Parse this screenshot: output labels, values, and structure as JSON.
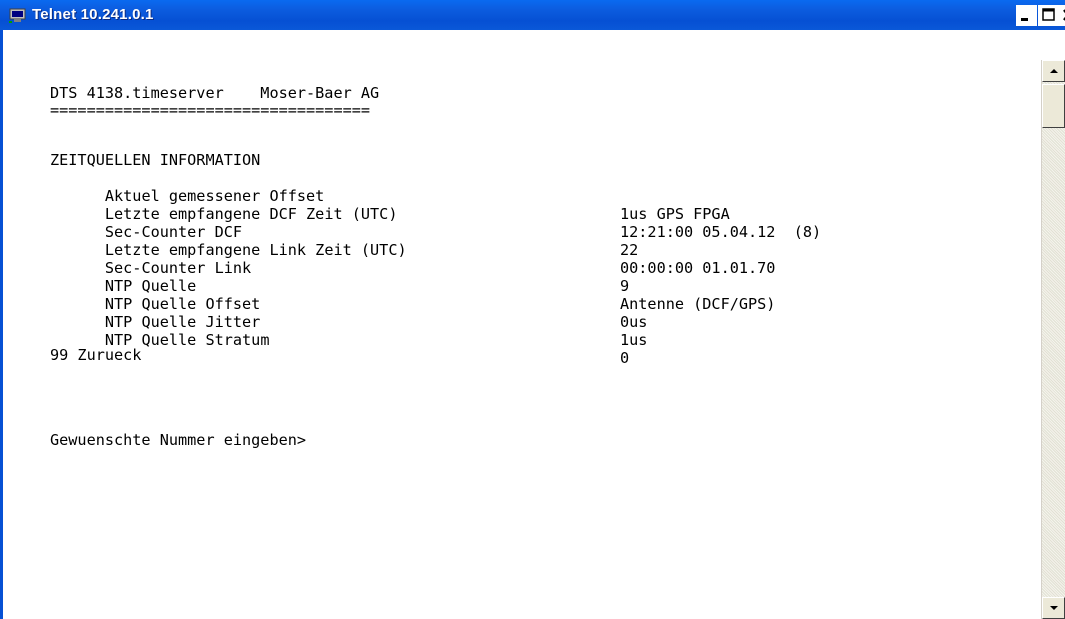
{
  "window": {
    "title": "Telnet 10.241.0.1",
    "icon": "telnet-terminal-icon",
    "controls": [
      "minimize-icon",
      "maximize-icon",
      "close-icon"
    ]
  },
  "terminal": {
    "header": "DTS 4138.timeserver    Moser-Baer AG",
    "separator": "===================================",
    "section_title": "ZEITQUELLEN INFORMATION",
    "rows": [
      {
        "label": "Aktuel gemessener Offset",
        "value": "1us GPS FPGA"
      },
      {
        "label": "Letzte empfangene DCF Zeit (UTC)",
        "value": "12:21:00 05.04.12  (8)"
      },
      {
        "label": "Sec-Counter DCF",
        "value": "22"
      },
      {
        "label": "Letzte empfangene Link Zeit (UTC)",
        "value": "00:00:00 01.01.70"
      },
      {
        "label": "Sec-Counter Link",
        "value": "9"
      },
      {
        "label": "NTP Quelle",
        "value": "Antenne (DCF/GPS)"
      },
      {
        "label": "NTP Quelle Offset",
        "value": "0us"
      },
      {
        "label": "NTP Quelle Jitter",
        "value": "1us"
      },
      {
        "label": "NTP Quelle Stratum",
        "value": "0"
      }
    ],
    "back_option": "99 Zurueck",
    "prompt": "Gewuenschte Nummer eingeben>"
  },
  "scrollbar": {
    "up_icon": "scroll-up-arrow-icon",
    "down_icon": "scroll-down-arrow-icon"
  }
}
